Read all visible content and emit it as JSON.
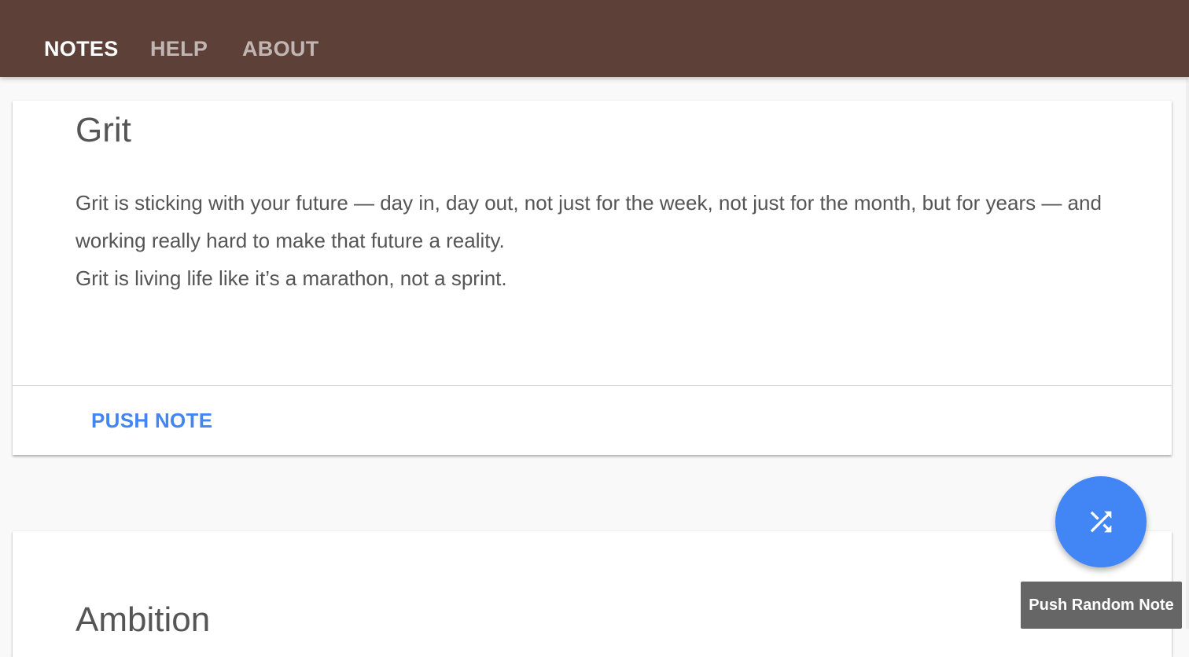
{
  "nav": {
    "tabs": [
      {
        "label": "NOTES",
        "active": true
      },
      {
        "label": "HELP",
        "active": false
      },
      {
        "label": "ABOUT",
        "active": false
      }
    ]
  },
  "notes": [
    {
      "title": "Grit",
      "lines": [
        "Grit is sticking with your future — day in, day out, not just for the week, not just for the month, but for years — and working really hard to make that future a reality.",
        "Grit is living life like it’s a marathon, not a sprint."
      ],
      "action_label": "PUSH NOTE"
    },
    {
      "title": "Ambition"
    }
  ],
  "fab": {
    "icon": "shuffle-icon",
    "tooltip": "Push Random Note"
  },
  "colors": {
    "appbar": "#5d4037",
    "accent": "#4285f4",
    "text": "#555555",
    "tooltip_bg": "#666666"
  }
}
